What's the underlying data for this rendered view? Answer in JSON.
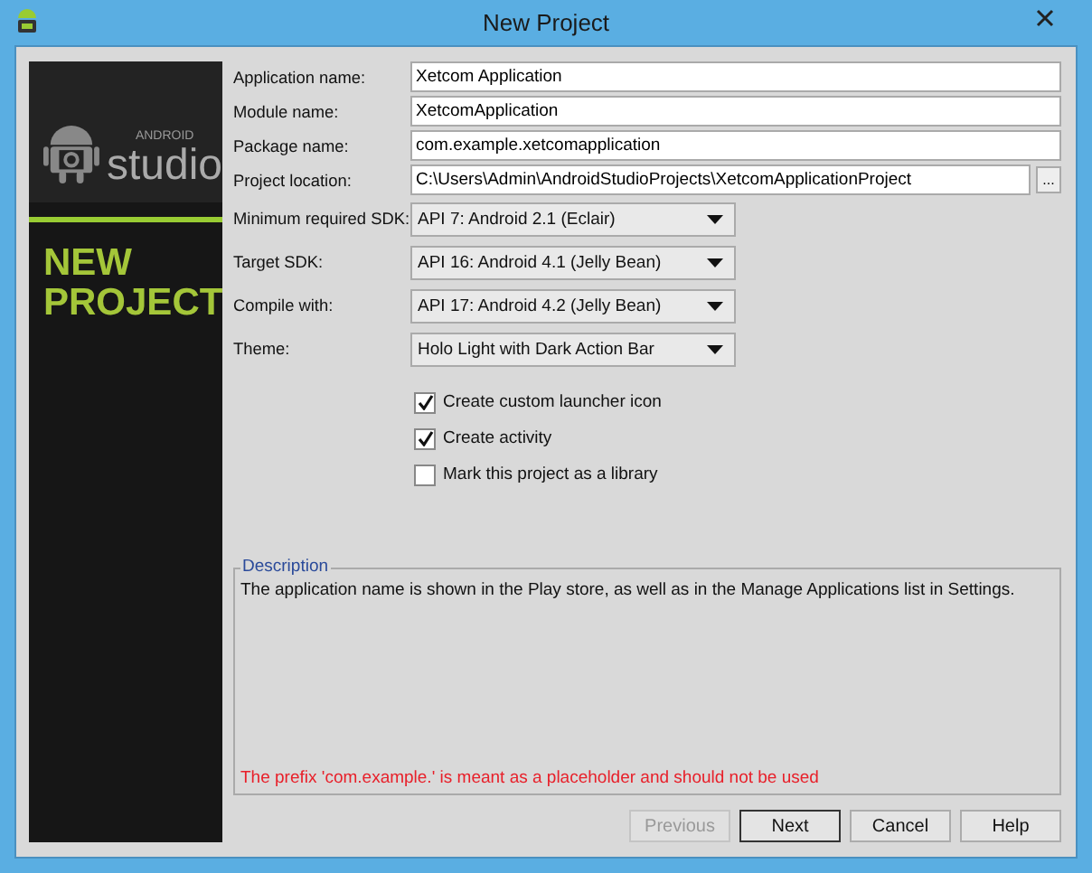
{
  "window": {
    "title": "New Project"
  },
  "sidebar": {
    "logo_small": "ANDROID",
    "logo_large": "studio",
    "heading": [
      "NEW",
      "PROJECT"
    ]
  },
  "text_fields": [
    {
      "label": "Application name:",
      "value": "Xetcom Application"
    },
    {
      "label": "Module name:",
      "value": "XetcomApplication"
    },
    {
      "label": "Package name:",
      "value": "com.example.xetcomapplication"
    },
    {
      "label": "Project location:",
      "value": "C:\\Users\\Admin\\AndroidStudioProjects\\XetcomApplicationProject",
      "browse": "..."
    }
  ],
  "dropdowns": [
    {
      "label": "Minimum required SDK:",
      "value": "API 7: Android 2.1 (Eclair)"
    },
    {
      "label": "Target SDK:",
      "value": "API 16: Android 4.1 (Jelly Bean)"
    },
    {
      "label": "Compile with:",
      "value": "API 17: Android 4.2 (Jelly Bean)"
    },
    {
      "label": "Theme:",
      "value": "Holo Light with Dark Action Bar"
    }
  ],
  "checkboxes": [
    {
      "label": "Create custom launcher icon",
      "checked": true
    },
    {
      "label": "Create activity",
      "checked": true
    },
    {
      "label": "Mark this project as a library",
      "checked": false
    }
  ],
  "description": {
    "title": "Description",
    "text": "The application name is shown in the Play store, as well as in the Manage Applications list in Settings.",
    "error": "The prefix 'com.example.' is meant as a placeholder and should not be used"
  },
  "buttons": [
    {
      "label": "Previous",
      "disabled": true,
      "default": false
    },
    {
      "label": "Next",
      "disabled": false,
      "default": true
    },
    {
      "label": "Cancel",
      "disabled": false,
      "default": false
    },
    {
      "label": "Help",
      "disabled": false,
      "default": false
    }
  ]
}
